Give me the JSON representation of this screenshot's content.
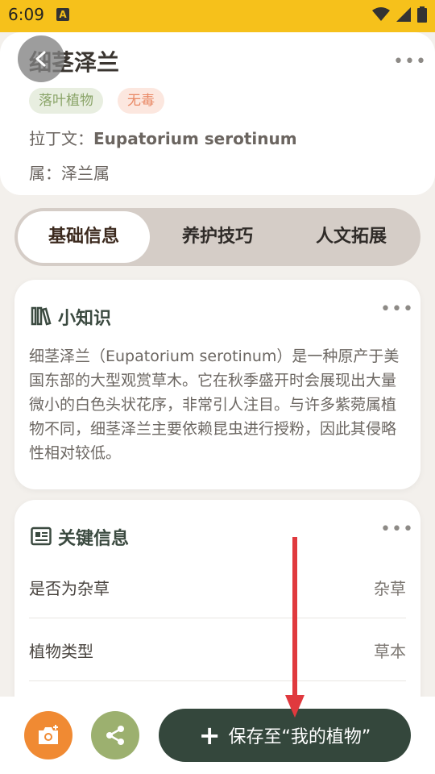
{
  "status_bar": {
    "time": "6:09",
    "notif_letter": "A"
  },
  "header": {
    "title": "细茎泽兰",
    "tags": [
      "落叶植物",
      "无毒"
    ],
    "latin_label": "拉丁文：",
    "latin_name": "Eupatorium serotinum",
    "genus_label": "属：",
    "genus": "泽兰属",
    "more": "•••"
  },
  "tabs": [
    {
      "label": "基础信息",
      "active": true
    },
    {
      "label": "养护技巧",
      "active": false
    },
    {
      "label": "人文拓展",
      "active": false
    }
  ],
  "knowledge_card": {
    "title": "小知识",
    "more": "•••",
    "text": "细茎泽兰（Eupatorium serotinum）是一种原产于美国东部的大型观赏草木。它在秋季盛开时会展现出大量微小的白色头状花序，非常引人注目。与许多紫菀属植物不同，细茎泽兰主要依赖昆虫进行授粉，因此其侵略性相对较低。"
  },
  "key_info_card": {
    "title": "关键信息",
    "more": "•••",
    "rows": [
      {
        "label": "是否为杂草",
        "value": "杂草"
      },
      {
        "label": "植物类型",
        "value": "草本"
      }
    ]
  },
  "bottom_bar": {
    "save_label": "保存至“我的植物”",
    "plus": "+"
  },
  "colors": {
    "status_bar": "#f6c11b",
    "primary_dark": "#34473c",
    "camera": "#f08a33",
    "share": "#9cb06f",
    "arrow": "#e0393e"
  },
  "icons": [
    "back-icon",
    "more-icon",
    "books-icon",
    "id-card-icon",
    "camera-icon",
    "share-icon",
    "plus-icon",
    "wifi-icon",
    "signal-icon",
    "battery-icon"
  ]
}
